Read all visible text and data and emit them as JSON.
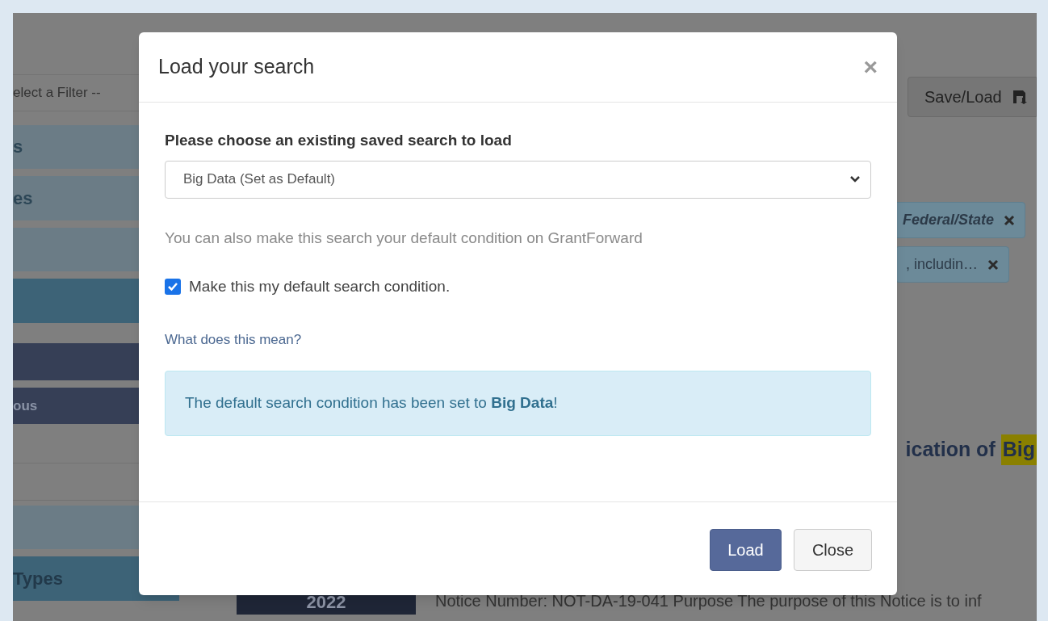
{
  "background": {
    "filter_select": {
      "value": "elect a Filter --"
    },
    "sidebar_items": [
      {
        "label": "s",
        "kind": "light"
      },
      {
        "label": "es",
        "kind": "light"
      },
      {
        "kind": "light"
      },
      {
        "kind": "teal"
      },
      {
        "kind": "navy"
      },
      {
        "label": "ous",
        "kind": "navy"
      },
      {
        "kind": "plain"
      },
      {
        "kind": "plain"
      },
      {
        "kind": "light"
      },
      {
        "label": "Types",
        "kind": "teal"
      }
    ],
    "save_load_button": "Save/Load",
    "filter_chips": [
      {
        "label": "Federal/State",
        "italic": true
      },
      {
        "label": ", includin…",
        "italic": false
      }
    ],
    "result_title": {
      "text": "ication of",
      "highlight": "Big"
    },
    "result_year": "2022",
    "result_text": "Notice Number: NOT-DA-19-041 Purpose The purpose of this Notice is to inf"
  },
  "dialog": {
    "title": "Load your search",
    "close": "×",
    "select_label": "Please choose an existing saved search to load",
    "select_value": "Big Data (Set as Default)",
    "hint": "You can also make this search your default condition on GrantForward",
    "default_checkbox": {
      "label": "Make this my default search condition.",
      "checked": true
    },
    "help_link": "What does this mean?",
    "alert": "The default search condition has been set to **Big Data**!",
    "buttons": [
      {
        "label": "Load",
        "kind": "primary"
      },
      {
        "label": "Close",
        "kind": "default"
      }
    ]
  }
}
